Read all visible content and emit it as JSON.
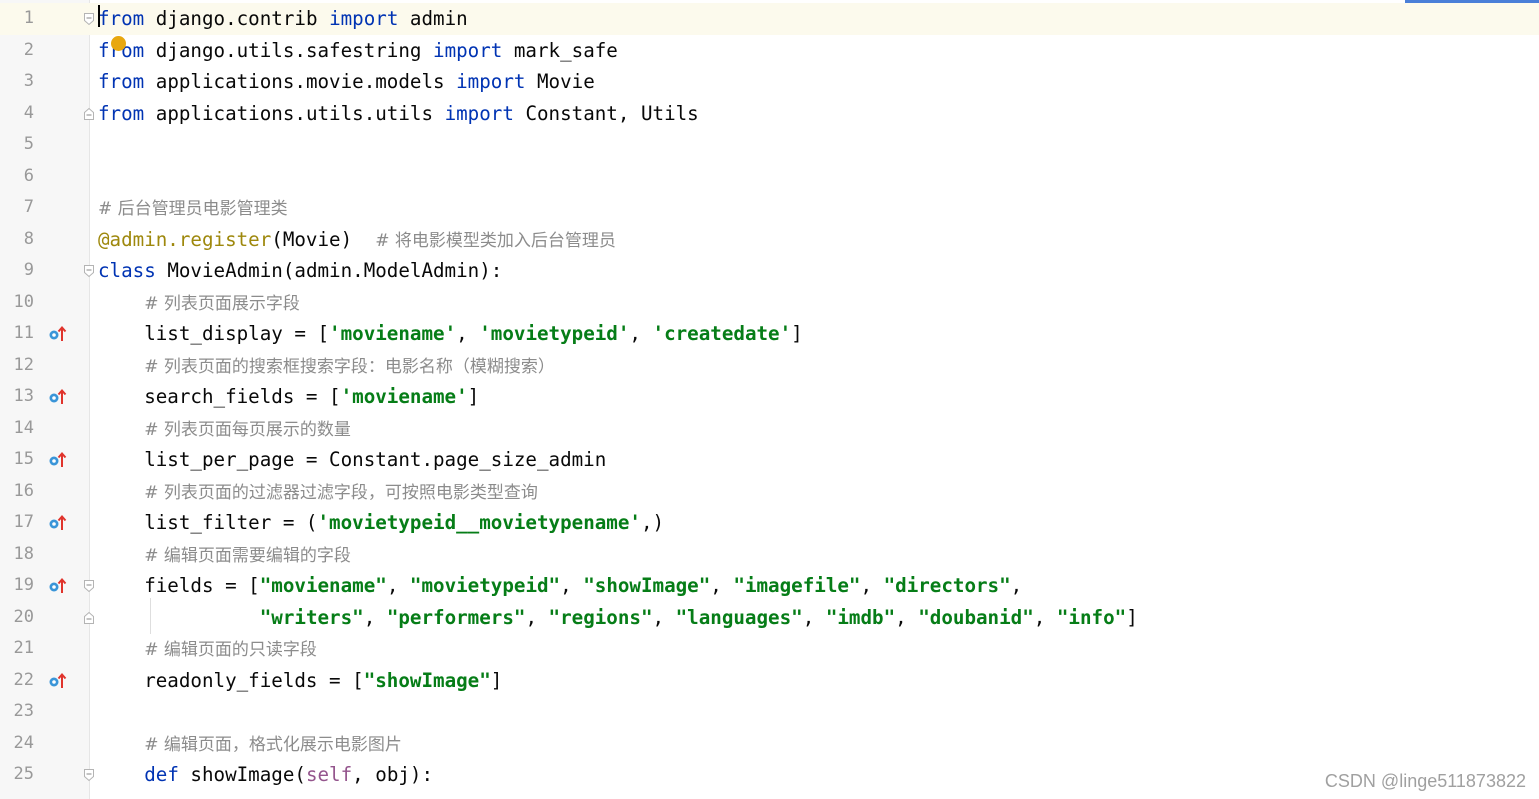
{
  "editor": {
    "colors": {
      "keyword": "#0033b3",
      "string": "#067d17",
      "comment": "#8c8c8c",
      "decorator": "#9e880d",
      "self": "#94558d",
      "line_number": "#999999",
      "current_line": "#fcfaed"
    },
    "lines": [
      {
        "num": "1",
        "marker": false,
        "fold": "start",
        "tokens": [
          {
            "t": "from",
            "c": "kw"
          },
          {
            "t": " django.contrib "
          },
          {
            "t": "import",
            "c": "kw"
          },
          {
            "t": " admin"
          }
        ]
      },
      {
        "num": "2",
        "marker": false,
        "fold": "",
        "tokens": [
          {
            "t": "from",
            "c": "kw"
          },
          {
            "t": " django.utils.safestring "
          },
          {
            "t": "import",
            "c": "kw"
          },
          {
            "t": " mark_safe"
          }
        ]
      },
      {
        "num": "3",
        "marker": false,
        "fold": "",
        "tokens": [
          {
            "t": "from",
            "c": "kw"
          },
          {
            "t": " applications.movie.models "
          },
          {
            "t": "import",
            "c": "kw"
          },
          {
            "t": " Movie"
          }
        ]
      },
      {
        "num": "4",
        "marker": false,
        "fold": "end",
        "tokens": [
          {
            "t": "from",
            "c": "kw"
          },
          {
            "t": " applications.utils.utils "
          },
          {
            "t": "import",
            "c": "kw"
          },
          {
            "t": " Constant, Utils"
          }
        ]
      },
      {
        "num": "5",
        "marker": false,
        "fold": "",
        "tokens": []
      },
      {
        "num": "6",
        "marker": false,
        "fold": "",
        "tokens": []
      },
      {
        "num": "7",
        "marker": false,
        "fold": "",
        "tokens": [
          {
            "t": "# 后台管理员电影管理类",
            "c": "cmt"
          }
        ]
      },
      {
        "num": "8",
        "marker": false,
        "fold": "",
        "tokens": [
          {
            "t": "@admin.register",
            "c": "dec"
          },
          {
            "t": "(Movie)  "
          },
          {
            "t": "# 将电影模型类加入后台管理员",
            "c": "cmt"
          }
        ]
      },
      {
        "num": "9",
        "marker": false,
        "fold": "start",
        "tokens": [
          {
            "t": "class",
            "c": "kw"
          },
          {
            "t": " MovieAdmin(admin.ModelAdmin):"
          }
        ]
      },
      {
        "num": "10",
        "marker": false,
        "fold": "",
        "tokens": [
          {
            "t": "    "
          },
          {
            "t": "# 列表页面展示字段",
            "c": "cmt"
          }
        ]
      },
      {
        "num": "11",
        "marker": true,
        "fold": "",
        "tokens": [
          {
            "t": "    list_display = ["
          },
          {
            "t": "'moviename'",
            "c": "str"
          },
          {
            "t": ", "
          },
          {
            "t": "'movietypeid'",
            "c": "str"
          },
          {
            "t": ", "
          },
          {
            "t": "'createdate'",
            "c": "str"
          },
          {
            "t": "]"
          }
        ]
      },
      {
        "num": "12",
        "marker": false,
        "fold": "",
        "tokens": [
          {
            "t": "    "
          },
          {
            "t": "# 列表页面的搜索框搜索字段：电影名称（模糊搜索）",
            "c": "cmt"
          }
        ]
      },
      {
        "num": "13",
        "marker": true,
        "fold": "",
        "tokens": [
          {
            "t": "    search_fields = ["
          },
          {
            "t": "'moviename'",
            "c": "str"
          },
          {
            "t": "]"
          }
        ]
      },
      {
        "num": "14",
        "marker": false,
        "fold": "",
        "tokens": [
          {
            "t": "    "
          },
          {
            "t": "# 列表页面每页展示的数量",
            "c": "cmt"
          }
        ]
      },
      {
        "num": "15",
        "marker": true,
        "fold": "",
        "tokens": [
          {
            "t": "    list_per_page = Constant.page_size_admin"
          }
        ]
      },
      {
        "num": "16",
        "marker": false,
        "fold": "",
        "tokens": [
          {
            "t": "    "
          },
          {
            "t": "# 列表页面的过滤器过滤字段，可按照电影类型查询",
            "c": "cmt"
          }
        ]
      },
      {
        "num": "17",
        "marker": true,
        "fold": "",
        "tokens": [
          {
            "t": "    list_filter = ("
          },
          {
            "t": "'movietypeid__movietypename'",
            "c": "str"
          },
          {
            "t": ",)"
          }
        ]
      },
      {
        "num": "18",
        "marker": false,
        "fold": "",
        "tokens": [
          {
            "t": "    "
          },
          {
            "t": "# 编辑页面需要编辑的字段",
            "c": "cmt"
          }
        ]
      },
      {
        "num": "19",
        "marker": true,
        "fold": "start",
        "tokens": [
          {
            "t": "    fields = ["
          },
          {
            "t": "\"moviename\"",
            "c": "str"
          },
          {
            "t": ", "
          },
          {
            "t": "\"movietypeid\"",
            "c": "str"
          },
          {
            "t": ", "
          },
          {
            "t": "\"showImage\"",
            "c": "str"
          },
          {
            "t": ", "
          },
          {
            "t": "\"imagefile\"",
            "c": "str"
          },
          {
            "t": ", "
          },
          {
            "t": "\"directors\"",
            "c": "str"
          },
          {
            "t": ","
          }
        ]
      },
      {
        "num": "20",
        "marker": false,
        "fold": "end",
        "tokens": [
          {
            "t": "              "
          },
          {
            "t": "\"writers\"",
            "c": "str"
          },
          {
            "t": ", "
          },
          {
            "t": "\"performers\"",
            "c": "str"
          },
          {
            "t": ", "
          },
          {
            "t": "\"regions\"",
            "c": "str"
          },
          {
            "t": ", "
          },
          {
            "t": "\"languages\"",
            "c": "str"
          },
          {
            "t": ", "
          },
          {
            "t": "\"imdb\"",
            "c": "str"
          },
          {
            "t": ", "
          },
          {
            "t": "\"doubanid\"",
            "c": "str"
          },
          {
            "t": ", "
          },
          {
            "t": "\"info\"",
            "c": "str"
          },
          {
            "t": "]"
          }
        ]
      },
      {
        "num": "21",
        "marker": false,
        "fold": "",
        "tokens": [
          {
            "t": "    "
          },
          {
            "t": "# 编辑页面的只读字段",
            "c": "cmt"
          }
        ]
      },
      {
        "num": "22",
        "marker": true,
        "fold": "",
        "tokens": [
          {
            "t": "    readonly_fields = ["
          },
          {
            "t": "\"showImage\"",
            "c": "str"
          },
          {
            "t": "]"
          }
        ]
      },
      {
        "num": "23",
        "marker": false,
        "fold": "",
        "tokens": []
      },
      {
        "num": "24",
        "marker": false,
        "fold": "",
        "tokens": [
          {
            "t": "    "
          },
          {
            "t": "# 编辑页面，格式化展示电影图片",
            "c": "cmt"
          }
        ]
      },
      {
        "num": "25",
        "marker": false,
        "fold": "start",
        "tokens": [
          {
            "t": "    "
          },
          {
            "t": "def",
            "c": "kw"
          },
          {
            "t": " showImage("
          },
          {
            "t": "self",
            "c": "self"
          },
          {
            "t": ", obj):"
          }
        ]
      }
    ]
  },
  "icons": {
    "gutter_marker": "override-method-icon",
    "fold": "fold-marker-icon",
    "breakpoint": "intention-bulb-icon"
  },
  "watermark": "CSDN @linge511873822"
}
